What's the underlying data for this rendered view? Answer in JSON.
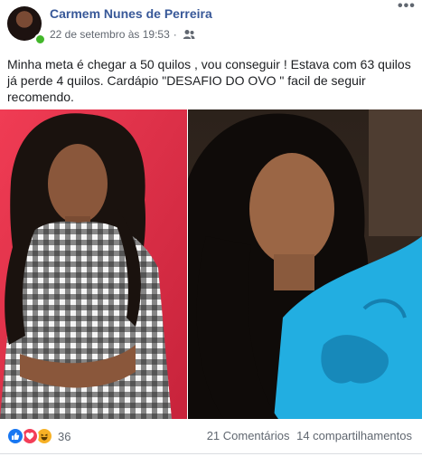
{
  "post": {
    "author": "Carmem Nunes de Perreira",
    "date": "22 de setembro às 19:53",
    "separator": "·",
    "audience_icon": "friends-icon",
    "more_icon": "more-options-icon",
    "text": "Minha meta é chegar a 50 quilos , vou conseguir ! Estava com 63 quilos já perde 4 quilos. Cardápio \"DESAFIO DO OVO \" facil de seguir recomendo."
  },
  "photos": [
    {
      "name": "before-photo",
      "background": "#e8334f",
      "top_color": "#ffffff"
    },
    {
      "name": "after-photo",
      "background": "#201812",
      "top_color": "#22aee1"
    }
  ],
  "reactions": {
    "types": [
      "like-reaction-icon",
      "love-reaction-icon",
      "haha-reaction-icon"
    ],
    "count": "36"
  },
  "stats": {
    "comments": "21 Comentários",
    "shares": "14 compartilhamentos"
  },
  "colors": {
    "author_link": "#385898",
    "meta_text": "#616770",
    "like": "#1877f2",
    "love": "#f33e58",
    "haha": "#f7b125",
    "online": "#42b72a"
  }
}
